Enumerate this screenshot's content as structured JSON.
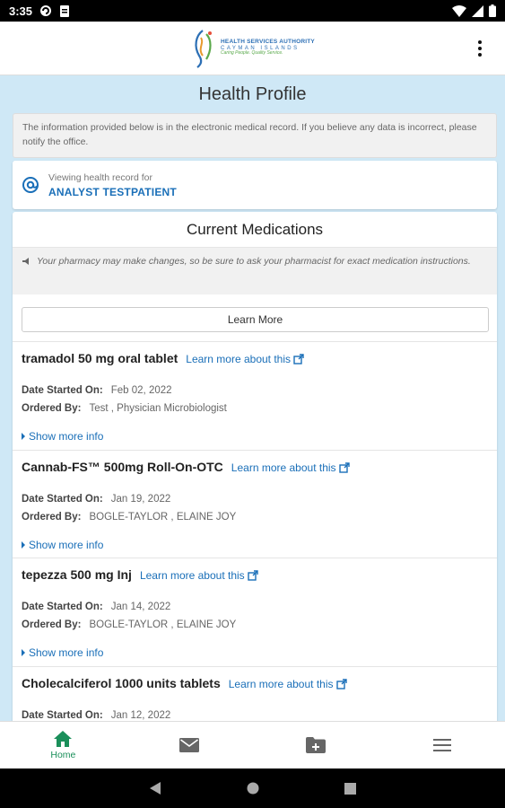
{
  "status_bar": {
    "time": "3:35"
  },
  "header": {
    "logo_line1": "HEALTH SERVICES AUTHORITY",
    "logo_line2": "CAYMAN ISLANDS",
    "logo_line3": "Caring People. Quality Service."
  },
  "page": {
    "title": "Health Profile",
    "notice": "The information provided below is in the electronic medical record. If you believe any data is incorrect, please notify the office.",
    "viewing_label": "Viewing health record for",
    "patient_name": "ANALYST TESTPATIENT"
  },
  "medications": {
    "title": "Current Medications",
    "pharmacy_note": "Your pharmacy may make changes, so be sure to ask your pharmacist for exact medication instructions.",
    "learn_more_button": "Learn More",
    "learn_link_label": "Learn more about this",
    "date_label": "Date Started On:",
    "ordered_label": "Ordered By:",
    "show_more": "Show more info",
    "items": [
      {
        "name": "tramadol 50 mg oral tablet",
        "date": "Feb 02, 2022",
        "ordered_by": "Test , Physician Microbiologist"
      },
      {
        "name": "Cannab-FS™ 500mg Roll-On-OTC",
        "date": "Jan 19, 2022",
        "ordered_by": "BOGLE-TAYLOR , ELAINE JOY"
      },
      {
        "name": "tepezza 500 mg Inj",
        "date": "Jan 14, 2022",
        "ordered_by": "BOGLE-TAYLOR , ELAINE JOY"
      },
      {
        "name": "Cholecalciferol 1000 units tablets",
        "date": "Jan 12, 2022",
        "ordered_by": ""
      }
    ]
  },
  "bottom_nav": {
    "home_label": "Home",
    "active_color": "#1a8f5a",
    "inactive_color": "#666666"
  },
  "colors": {
    "accent": "#1a6fb8",
    "background": "#cfe8f6"
  }
}
